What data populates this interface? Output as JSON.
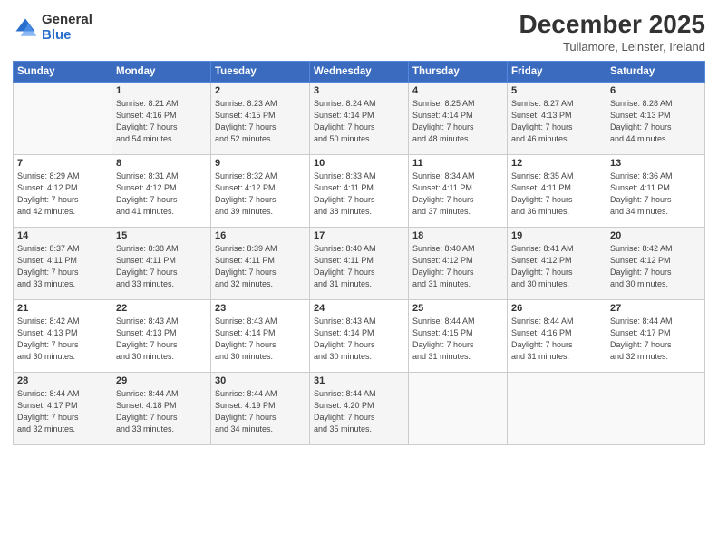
{
  "logo": {
    "general": "General",
    "blue": "Blue"
  },
  "header": {
    "month": "December 2025",
    "location": "Tullamore, Leinster, Ireland"
  },
  "days_of_week": [
    "Sunday",
    "Monday",
    "Tuesday",
    "Wednesday",
    "Thursday",
    "Friday",
    "Saturday"
  ],
  "weeks": [
    [
      {
        "day": "",
        "content": ""
      },
      {
        "day": "1",
        "content": "Sunrise: 8:21 AM\nSunset: 4:16 PM\nDaylight: 7 hours\nand 54 minutes."
      },
      {
        "day": "2",
        "content": "Sunrise: 8:23 AM\nSunset: 4:15 PM\nDaylight: 7 hours\nand 52 minutes."
      },
      {
        "day": "3",
        "content": "Sunrise: 8:24 AM\nSunset: 4:14 PM\nDaylight: 7 hours\nand 50 minutes."
      },
      {
        "day": "4",
        "content": "Sunrise: 8:25 AM\nSunset: 4:14 PM\nDaylight: 7 hours\nand 48 minutes."
      },
      {
        "day": "5",
        "content": "Sunrise: 8:27 AM\nSunset: 4:13 PM\nDaylight: 7 hours\nand 46 minutes."
      },
      {
        "day": "6",
        "content": "Sunrise: 8:28 AM\nSunset: 4:13 PM\nDaylight: 7 hours\nand 44 minutes."
      }
    ],
    [
      {
        "day": "7",
        "content": "Sunrise: 8:29 AM\nSunset: 4:12 PM\nDaylight: 7 hours\nand 42 minutes."
      },
      {
        "day": "8",
        "content": "Sunrise: 8:31 AM\nSunset: 4:12 PM\nDaylight: 7 hours\nand 41 minutes."
      },
      {
        "day": "9",
        "content": "Sunrise: 8:32 AM\nSunset: 4:12 PM\nDaylight: 7 hours\nand 39 minutes."
      },
      {
        "day": "10",
        "content": "Sunrise: 8:33 AM\nSunset: 4:11 PM\nDaylight: 7 hours\nand 38 minutes."
      },
      {
        "day": "11",
        "content": "Sunrise: 8:34 AM\nSunset: 4:11 PM\nDaylight: 7 hours\nand 37 minutes."
      },
      {
        "day": "12",
        "content": "Sunrise: 8:35 AM\nSunset: 4:11 PM\nDaylight: 7 hours\nand 36 minutes."
      },
      {
        "day": "13",
        "content": "Sunrise: 8:36 AM\nSunset: 4:11 PM\nDaylight: 7 hours\nand 34 minutes."
      }
    ],
    [
      {
        "day": "14",
        "content": "Sunrise: 8:37 AM\nSunset: 4:11 PM\nDaylight: 7 hours\nand 33 minutes."
      },
      {
        "day": "15",
        "content": "Sunrise: 8:38 AM\nSunset: 4:11 PM\nDaylight: 7 hours\nand 33 minutes."
      },
      {
        "day": "16",
        "content": "Sunrise: 8:39 AM\nSunset: 4:11 PM\nDaylight: 7 hours\nand 32 minutes."
      },
      {
        "day": "17",
        "content": "Sunrise: 8:40 AM\nSunset: 4:11 PM\nDaylight: 7 hours\nand 31 minutes."
      },
      {
        "day": "18",
        "content": "Sunrise: 8:40 AM\nSunset: 4:12 PM\nDaylight: 7 hours\nand 31 minutes."
      },
      {
        "day": "19",
        "content": "Sunrise: 8:41 AM\nSunset: 4:12 PM\nDaylight: 7 hours\nand 30 minutes."
      },
      {
        "day": "20",
        "content": "Sunrise: 8:42 AM\nSunset: 4:12 PM\nDaylight: 7 hours\nand 30 minutes."
      }
    ],
    [
      {
        "day": "21",
        "content": "Sunrise: 8:42 AM\nSunset: 4:13 PM\nDaylight: 7 hours\nand 30 minutes."
      },
      {
        "day": "22",
        "content": "Sunrise: 8:43 AM\nSunset: 4:13 PM\nDaylight: 7 hours\nand 30 minutes."
      },
      {
        "day": "23",
        "content": "Sunrise: 8:43 AM\nSunset: 4:14 PM\nDaylight: 7 hours\nand 30 minutes."
      },
      {
        "day": "24",
        "content": "Sunrise: 8:43 AM\nSunset: 4:14 PM\nDaylight: 7 hours\nand 30 minutes."
      },
      {
        "day": "25",
        "content": "Sunrise: 8:44 AM\nSunset: 4:15 PM\nDaylight: 7 hours\nand 31 minutes."
      },
      {
        "day": "26",
        "content": "Sunrise: 8:44 AM\nSunset: 4:16 PM\nDaylight: 7 hours\nand 31 minutes."
      },
      {
        "day": "27",
        "content": "Sunrise: 8:44 AM\nSunset: 4:17 PM\nDaylight: 7 hours\nand 32 minutes."
      }
    ],
    [
      {
        "day": "28",
        "content": "Sunrise: 8:44 AM\nSunset: 4:17 PM\nDaylight: 7 hours\nand 32 minutes."
      },
      {
        "day": "29",
        "content": "Sunrise: 8:44 AM\nSunset: 4:18 PM\nDaylight: 7 hours\nand 33 minutes."
      },
      {
        "day": "30",
        "content": "Sunrise: 8:44 AM\nSunset: 4:19 PM\nDaylight: 7 hours\nand 34 minutes."
      },
      {
        "day": "31",
        "content": "Sunrise: 8:44 AM\nSunset: 4:20 PM\nDaylight: 7 hours\nand 35 minutes."
      },
      {
        "day": "",
        "content": ""
      },
      {
        "day": "",
        "content": ""
      },
      {
        "day": "",
        "content": ""
      }
    ]
  ]
}
